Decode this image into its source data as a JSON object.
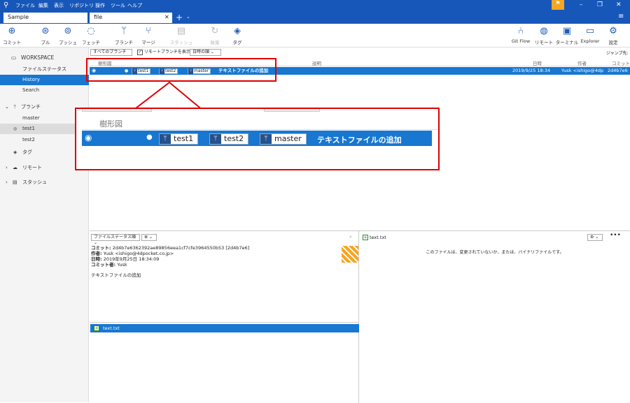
{
  "menu": [
    "ファイル",
    "編集",
    "表示",
    "リポジトリ",
    "操作",
    "ツール",
    "ヘルプ"
  ],
  "tabs": [
    {
      "label": "Sample"
    },
    {
      "label": "file"
    }
  ],
  "toolbar": {
    "commit": "コミット",
    "pull": "プル",
    "push": "プッシュ",
    "fetch": "フェッチ",
    "branch": "ブランチ",
    "merge": "マージ",
    "stash": "スタッシュ",
    "discard": "破棄",
    "tag": "タグ",
    "gitflow": "Git Flow",
    "remote": "リモート",
    "terminal": "ターミナル",
    "explorer": "Explorer",
    "settings": "設定"
  },
  "sidebar": {
    "workspace": "WORKSPACE",
    "file_status": "ファイルステータス",
    "history": "History",
    "search": "Search",
    "branches": "ブランチ",
    "branch_items": [
      "master",
      "test1",
      "test2"
    ],
    "tags": "タグ",
    "remotes": "リモート",
    "stashes": "スタッシュ"
  },
  "filters": {
    "branches": "すべてのブランチ",
    "show_remote": "リモートブランチを表示",
    "order": "日時の順",
    "jump": "ジャンプ先:"
  },
  "grid": {
    "headers": {
      "graph": "樹形図",
      "desc": "説明",
      "date": "日時",
      "author": "作者",
      "commit": "コミット"
    },
    "row": {
      "tags": [
        "test1",
        "test2",
        "master"
      ],
      "message": "テキストファイルの追加",
      "date": "2019/9/25 18:34",
      "author": "Yusk <ishigo@4dp",
      "hash": "2d4b7e6"
    }
  },
  "zoom": {
    "graph_header": "樹形図",
    "tags": [
      "test1",
      "test2",
      "master"
    ],
    "message": "テキストファイルの追加"
  },
  "details": {
    "sort": "ファイルステータス順",
    "commit_label": "コミット:",
    "commit_value": "2d4b7e6362392ae89856eea1cf7cfe3964550b53 [2d4b7e6]",
    "author_label": "作者:",
    "author_value": "Yusk <ishigo@4dpocket.co.jp>",
    "date_label": "日時:",
    "date_value": "2019年9月25日 18:34:09",
    "committer_label": "コミット者:",
    "committer_value": "Yusk",
    "message": "テキストファイルの追加",
    "file": "text.txt"
  },
  "diff": {
    "file": "text.txt",
    "message": "このファイルは、変更されていないか、または、バイナリファイルです。"
  },
  "colors": {
    "titlebar": "#1757b9",
    "selection": "#1777d1",
    "highlight": "#e00000",
    "flag": "#f5a623"
  }
}
